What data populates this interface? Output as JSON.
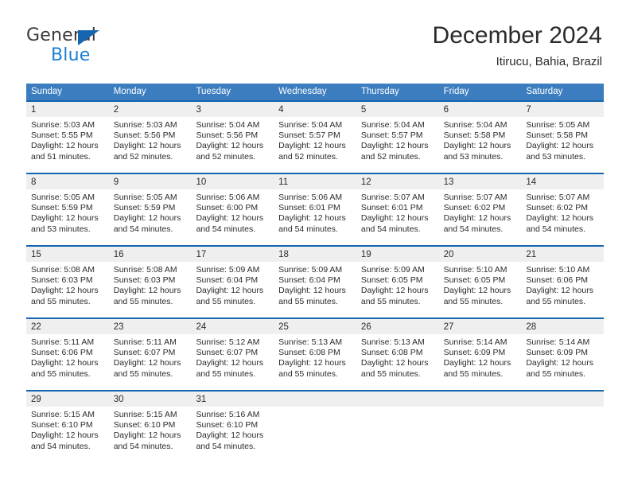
{
  "brand": {
    "name_part1": "General",
    "name_part2": "Blue",
    "triangle_color": "#1565b0",
    "blue_color": "#1b7fd4"
  },
  "header": {
    "title": "December 2024",
    "subtitle": "Itirucu, Bahia, Brazil"
  },
  "theme": {
    "header_blue": "#3b7dbf",
    "rule_blue": "#1565b0",
    "day_band_gray": "#efefef",
    "text": "#2b2b2b"
  },
  "weekdays": [
    "Sunday",
    "Monday",
    "Tuesday",
    "Wednesday",
    "Thursday",
    "Friday",
    "Saturday"
  ],
  "weeks": [
    [
      {
        "day": "1",
        "sunrise": "Sunrise: 5:03 AM",
        "sunset": "Sunset: 5:55 PM",
        "daylight_line1": "Daylight: 12 hours",
        "daylight_line2": "and 51 minutes."
      },
      {
        "day": "2",
        "sunrise": "Sunrise: 5:03 AM",
        "sunset": "Sunset: 5:56 PM",
        "daylight_line1": "Daylight: 12 hours",
        "daylight_line2": "and 52 minutes."
      },
      {
        "day": "3",
        "sunrise": "Sunrise: 5:04 AM",
        "sunset": "Sunset: 5:56 PM",
        "daylight_line1": "Daylight: 12 hours",
        "daylight_line2": "and 52 minutes."
      },
      {
        "day": "4",
        "sunrise": "Sunrise: 5:04 AM",
        "sunset": "Sunset: 5:57 PM",
        "daylight_line1": "Daylight: 12 hours",
        "daylight_line2": "and 52 minutes."
      },
      {
        "day": "5",
        "sunrise": "Sunrise: 5:04 AM",
        "sunset": "Sunset: 5:57 PM",
        "daylight_line1": "Daylight: 12 hours",
        "daylight_line2": "and 52 minutes."
      },
      {
        "day": "6",
        "sunrise": "Sunrise: 5:04 AM",
        "sunset": "Sunset: 5:58 PM",
        "daylight_line1": "Daylight: 12 hours",
        "daylight_line2": "and 53 minutes."
      },
      {
        "day": "7",
        "sunrise": "Sunrise: 5:05 AM",
        "sunset": "Sunset: 5:58 PM",
        "daylight_line1": "Daylight: 12 hours",
        "daylight_line2": "and 53 minutes."
      }
    ],
    [
      {
        "day": "8",
        "sunrise": "Sunrise: 5:05 AM",
        "sunset": "Sunset: 5:59 PM",
        "daylight_line1": "Daylight: 12 hours",
        "daylight_line2": "and 53 minutes."
      },
      {
        "day": "9",
        "sunrise": "Sunrise: 5:05 AM",
        "sunset": "Sunset: 5:59 PM",
        "daylight_line1": "Daylight: 12 hours",
        "daylight_line2": "and 54 minutes."
      },
      {
        "day": "10",
        "sunrise": "Sunrise: 5:06 AM",
        "sunset": "Sunset: 6:00 PM",
        "daylight_line1": "Daylight: 12 hours",
        "daylight_line2": "and 54 minutes."
      },
      {
        "day": "11",
        "sunrise": "Sunrise: 5:06 AM",
        "sunset": "Sunset: 6:01 PM",
        "daylight_line1": "Daylight: 12 hours",
        "daylight_line2": "and 54 minutes."
      },
      {
        "day": "12",
        "sunrise": "Sunrise: 5:07 AM",
        "sunset": "Sunset: 6:01 PM",
        "daylight_line1": "Daylight: 12 hours",
        "daylight_line2": "and 54 minutes."
      },
      {
        "day": "13",
        "sunrise": "Sunrise: 5:07 AM",
        "sunset": "Sunset: 6:02 PM",
        "daylight_line1": "Daylight: 12 hours",
        "daylight_line2": "and 54 minutes."
      },
      {
        "day": "14",
        "sunrise": "Sunrise: 5:07 AM",
        "sunset": "Sunset: 6:02 PM",
        "daylight_line1": "Daylight: 12 hours",
        "daylight_line2": "and 54 minutes."
      }
    ],
    [
      {
        "day": "15",
        "sunrise": "Sunrise: 5:08 AM",
        "sunset": "Sunset: 6:03 PM",
        "daylight_line1": "Daylight: 12 hours",
        "daylight_line2": "and 55 minutes."
      },
      {
        "day": "16",
        "sunrise": "Sunrise: 5:08 AM",
        "sunset": "Sunset: 6:03 PM",
        "daylight_line1": "Daylight: 12 hours",
        "daylight_line2": "and 55 minutes."
      },
      {
        "day": "17",
        "sunrise": "Sunrise: 5:09 AM",
        "sunset": "Sunset: 6:04 PM",
        "daylight_line1": "Daylight: 12 hours",
        "daylight_line2": "and 55 minutes."
      },
      {
        "day": "18",
        "sunrise": "Sunrise: 5:09 AM",
        "sunset": "Sunset: 6:04 PM",
        "daylight_line1": "Daylight: 12 hours",
        "daylight_line2": "and 55 minutes."
      },
      {
        "day": "19",
        "sunrise": "Sunrise: 5:09 AM",
        "sunset": "Sunset: 6:05 PM",
        "daylight_line1": "Daylight: 12 hours",
        "daylight_line2": "and 55 minutes."
      },
      {
        "day": "20",
        "sunrise": "Sunrise: 5:10 AM",
        "sunset": "Sunset: 6:05 PM",
        "daylight_line1": "Daylight: 12 hours",
        "daylight_line2": "and 55 minutes."
      },
      {
        "day": "21",
        "sunrise": "Sunrise: 5:10 AM",
        "sunset": "Sunset: 6:06 PM",
        "daylight_line1": "Daylight: 12 hours",
        "daylight_line2": "and 55 minutes."
      }
    ],
    [
      {
        "day": "22",
        "sunrise": "Sunrise: 5:11 AM",
        "sunset": "Sunset: 6:06 PM",
        "daylight_line1": "Daylight: 12 hours",
        "daylight_line2": "and 55 minutes."
      },
      {
        "day": "23",
        "sunrise": "Sunrise: 5:11 AM",
        "sunset": "Sunset: 6:07 PM",
        "daylight_line1": "Daylight: 12 hours",
        "daylight_line2": "and 55 minutes."
      },
      {
        "day": "24",
        "sunrise": "Sunrise: 5:12 AM",
        "sunset": "Sunset: 6:07 PM",
        "daylight_line1": "Daylight: 12 hours",
        "daylight_line2": "and 55 minutes."
      },
      {
        "day": "25",
        "sunrise": "Sunrise: 5:13 AM",
        "sunset": "Sunset: 6:08 PM",
        "daylight_line1": "Daylight: 12 hours",
        "daylight_line2": "and 55 minutes."
      },
      {
        "day": "26",
        "sunrise": "Sunrise: 5:13 AM",
        "sunset": "Sunset: 6:08 PM",
        "daylight_line1": "Daylight: 12 hours",
        "daylight_line2": "and 55 minutes."
      },
      {
        "day": "27",
        "sunrise": "Sunrise: 5:14 AM",
        "sunset": "Sunset: 6:09 PM",
        "daylight_line1": "Daylight: 12 hours",
        "daylight_line2": "and 55 minutes."
      },
      {
        "day": "28",
        "sunrise": "Sunrise: 5:14 AM",
        "sunset": "Sunset: 6:09 PM",
        "daylight_line1": "Daylight: 12 hours",
        "daylight_line2": "and 55 minutes."
      }
    ],
    [
      {
        "day": "29",
        "sunrise": "Sunrise: 5:15 AM",
        "sunset": "Sunset: 6:10 PM",
        "daylight_line1": "Daylight: 12 hours",
        "daylight_line2": "and 54 minutes."
      },
      {
        "day": "30",
        "sunrise": "Sunrise: 5:15 AM",
        "sunset": "Sunset: 6:10 PM",
        "daylight_line1": "Daylight: 12 hours",
        "daylight_line2": "and 54 minutes."
      },
      {
        "day": "31",
        "sunrise": "Sunrise: 5:16 AM",
        "sunset": "Sunset: 6:10 PM",
        "daylight_line1": "Daylight: 12 hours",
        "daylight_line2": "and 54 minutes."
      },
      {
        "day": "",
        "sunrise": "",
        "sunset": "",
        "daylight_line1": "",
        "daylight_line2": ""
      },
      {
        "day": "",
        "sunrise": "",
        "sunset": "",
        "daylight_line1": "",
        "daylight_line2": ""
      },
      {
        "day": "",
        "sunrise": "",
        "sunset": "",
        "daylight_line1": "",
        "daylight_line2": ""
      },
      {
        "day": "",
        "sunrise": "",
        "sunset": "",
        "daylight_line1": "",
        "daylight_line2": ""
      }
    ]
  ]
}
